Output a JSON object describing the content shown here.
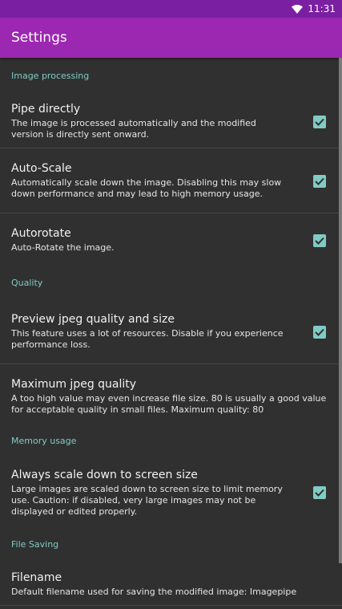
{
  "status_bar": {
    "time": "11:31",
    "wifi_icon": "wifi-icon"
  },
  "app_bar": {
    "title": "Settings"
  },
  "colors": {
    "status_bar": "#7b1fa2",
    "app_bar": "#9c27b0",
    "background": "#303030",
    "accent": "#80cbc4"
  },
  "sections": {
    "image_processing": {
      "header": "Image processing",
      "pipe_directly": {
        "title": "Pipe directly",
        "summary": "The image is processed automatically and the modified version is directly sent onward.",
        "checked": true
      },
      "auto_scale": {
        "title": "Auto-Scale",
        "summary": "Automatically scale down the image. Disabling this may slow down performance and may lead to high memory usage.",
        "checked": true
      },
      "autorotate": {
        "title": "Autorotate",
        "summary": "Auto-Rotate the image.",
        "checked": true
      }
    },
    "quality": {
      "header": "Quality",
      "preview": {
        "title": "Preview jpeg quality and size",
        "summary": "This feature uses a lot of resources. Disable if you experience performance loss.",
        "checked": true
      },
      "max_quality": {
        "title": "Maximum jpeg quality",
        "summary": "A too high value may even increase file size. 80 is usually a good value for acceptable quality in small files. Maximum quality: 80"
      }
    },
    "memory_usage": {
      "header": "Memory usage",
      "scale_down": {
        "title": "Always scale down to screen size",
        "summary": "Large images are scaled down to screen size to limit memory use. Caution: if disabled, very large images may not be displayed or edited properly.",
        "checked": true
      }
    },
    "file_saving": {
      "header": "File Saving",
      "filename": {
        "title": "Filename",
        "summary": "Default filename used for saving the modified image: Imagepipe"
      }
    }
  }
}
